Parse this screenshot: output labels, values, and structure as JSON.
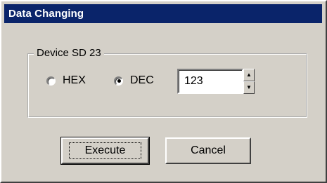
{
  "window": {
    "title": "Data Changing"
  },
  "group": {
    "label": "Device SD 23"
  },
  "radix": {
    "hex_label": "HEX",
    "dec_label": "DEC",
    "selected": "DEC"
  },
  "value": {
    "current": "123"
  },
  "spinner": {
    "up_glyph": "▲",
    "down_glyph": "▼"
  },
  "buttons": {
    "execute_label": "Execute",
    "cancel_label": "Cancel"
  },
  "colors": {
    "titlebar": "#0a246a",
    "face": "#d4d0c8"
  }
}
